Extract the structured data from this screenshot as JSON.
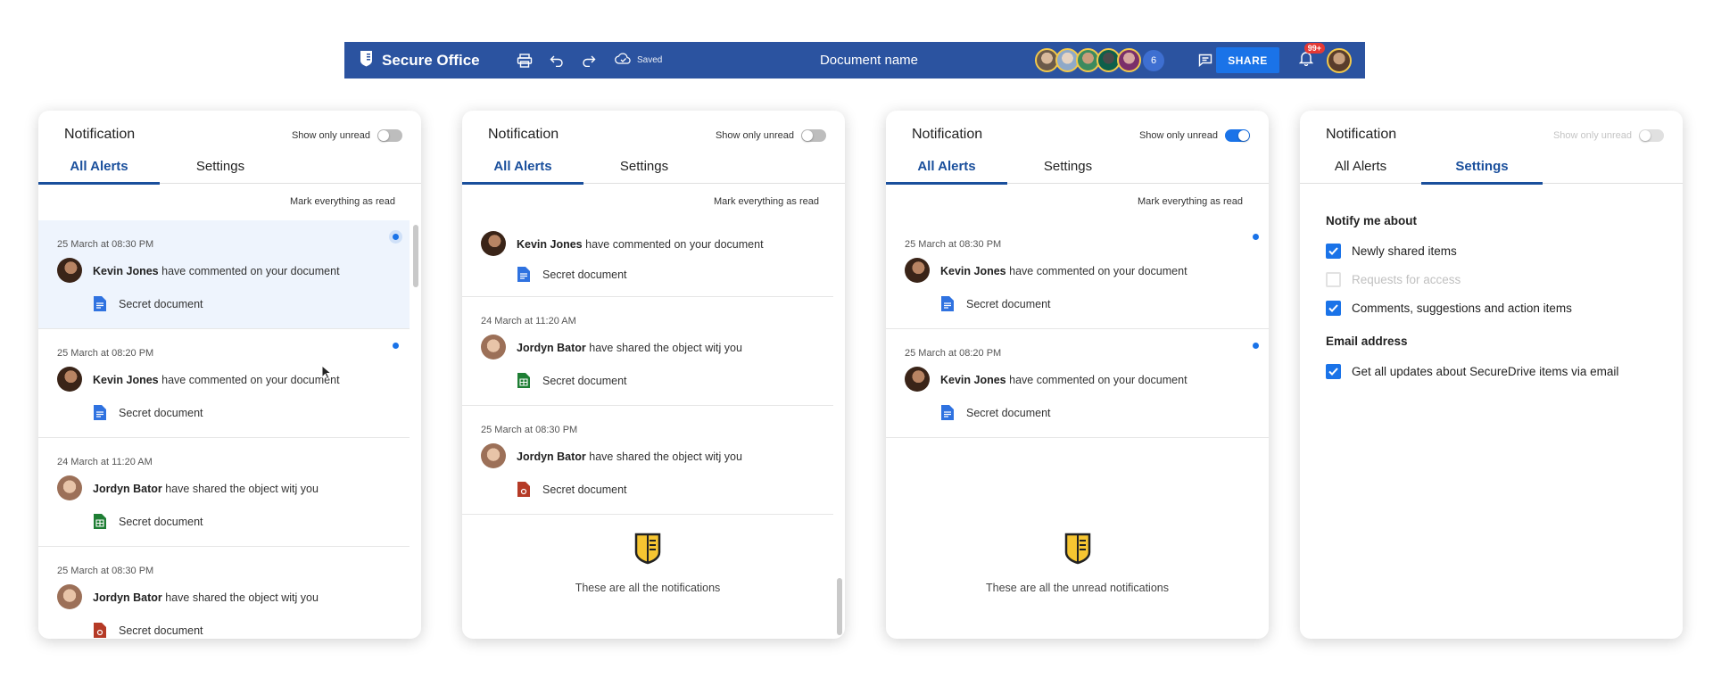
{
  "topbar": {
    "app_title": "Secure Office",
    "saved_label": "Saved",
    "document_name": "Document name",
    "collaborators_extra_count": "6",
    "share_label": "SHARE",
    "notification_badge": "99+"
  },
  "panels": [
    {
      "title": "Notification",
      "unread_label": "Show only unread",
      "unread_on": false,
      "tabs": [
        "All Alerts",
        "Settings"
      ],
      "active_tab": "All Alerts",
      "mark_all_label": "Mark everything as read",
      "items": [
        {
          "date": "25 March at 08:30 PM",
          "name": "Kevin Jones",
          "action": "have commented on your document",
          "doc": "Secret document",
          "doc_type": "doc",
          "unread": true,
          "selected": true
        },
        {
          "date": "25 March at 08:20 PM",
          "name": "Kevin Jones",
          "action": "have commented on your document",
          "doc": "Secret document",
          "doc_type": "doc",
          "unread": true
        },
        {
          "date": "24 March at 11:20 AM",
          "name": "Jordyn Bator",
          "action": "have shared the object witj you",
          "doc": "Secret document",
          "doc_type": "sheet",
          "unread": false
        },
        {
          "date": "25 March at 08:30 PM",
          "name": "Jordyn Bator",
          "action": "have shared the object witj you",
          "doc": "Secret document",
          "doc_type": "pdf",
          "unread": false
        }
      ]
    },
    {
      "title": "Notification",
      "unread_label": "Show only unread",
      "unread_on": false,
      "tabs": [
        "All Alerts",
        "Settings"
      ],
      "active_tab": "All Alerts",
      "mark_all_label": "Mark everything as read",
      "items": [
        {
          "name": "Kevin Jones",
          "action": "have commented on your document",
          "doc": "Secret document",
          "doc_type": "doc"
        },
        {
          "date": "24 March at 11:20 AM",
          "name": "Jordyn Bator",
          "action": "have shared the object witj you",
          "doc": "Secret document",
          "doc_type": "sheet"
        },
        {
          "date": "25 March at 08:30 PM",
          "name": "Jordyn Bator",
          "action": "have shared the object witj you",
          "doc": "Secret document",
          "doc_type": "pdf"
        }
      ],
      "end_text": "These are all the notifications"
    },
    {
      "title": "Notification",
      "unread_label": "Show only unread",
      "unread_on": true,
      "tabs": [
        "All Alerts",
        "Settings"
      ],
      "active_tab": "All Alerts",
      "mark_all_label": "Mark everything as read",
      "items": [
        {
          "date": "25 March at 08:30 PM",
          "name": "Kevin Jones",
          "action": "have commented on your document",
          "doc": "Secret document",
          "doc_type": "doc",
          "unread": true
        },
        {
          "date": "25 March at 08:20 PM",
          "name": "Kevin Jones",
          "action": "have commented on your document",
          "doc": "Secret document",
          "doc_type": "doc",
          "unread": true
        }
      ],
      "end_text": "These are all the unread notifications"
    },
    {
      "title": "Notification",
      "unread_label": "Show only unread",
      "unread_on": false,
      "tabs": [
        "All Alerts",
        "Settings"
      ],
      "active_tab": "Settings",
      "settings": {
        "notify_heading": "Notify me about",
        "options": [
          {
            "label": "Newly shared items",
            "checked": true,
            "disabled": false
          },
          {
            "label": "Requests for access",
            "checked": false,
            "disabled": true
          },
          {
            "label": "Comments, suggestions and action items",
            "checked": true,
            "disabled": false
          }
        ],
        "email_heading": "Email address",
        "email_option": {
          "label": "Get all updates about SecureDrive items via email",
          "checked": true
        }
      }
    }
  ],
  "colors": {
    "topbar": "#2b53a0",
    "accent": "#1a73e8",
    "tab_active": "#1a4f9c",
    "selected_row": "#eef4fd",
    "doc_icon": "#2f72e0",
    "sheet_icon": "#1e7e34",
    "pdf_icon": "#b53a26",
    "shield_icon": "#f6c531"
  }
}
